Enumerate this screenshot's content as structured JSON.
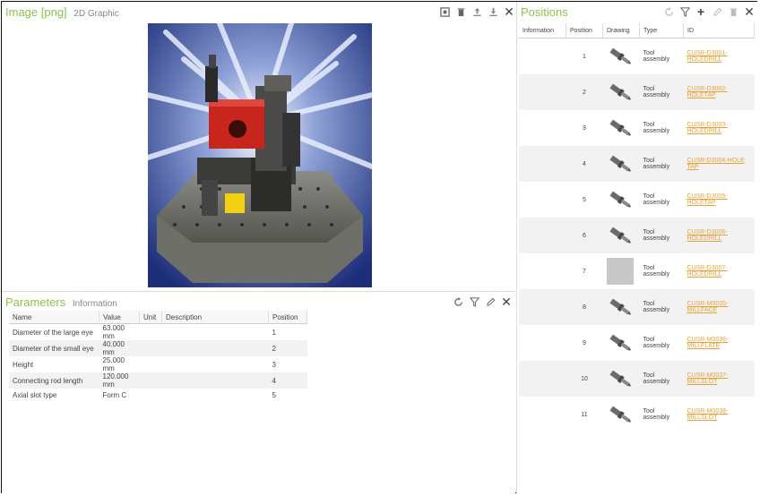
{
  "image_pane": {
    "tab_active": "Image [png]",
    "tab_inactive": "2D Graphic"
  },
  "parameters_pane": {
    "tab_active": "Parameters",
    "tab_inactive": "Information",
    "columns": [
      "Name",
      "Value",
      "Unit",
      "Description",
      "Position"
    ],
    "rows": [
      {
        "name": "Diameter of the large eye",
        "value": "63.000 mm",
        "unit": "",
        "description": "",
        "position": "1"
      },
      {
        "name": "Diameter of the small eye",
        "value": "40.000 mm",
        "unit": "",
        "description": "",
        "position": "2"
      },
      {
        "name": "Height",
        "value": "25.000 mm",
        "unit": "",
        "description": "",
        "position": "3"
      },
      {
        "name": "Connecting rod length",
        "value": "120.000 mm",
        "unit": "",
        "description": "",
        "position": "4"
      },
      {
        "name": "Axial slot type",
        "value": "Form C",
        "unit": "",
        "description": "",
        "position": "5"
      }
    ]
  },
  "positions_pane": {
    "title": "Positions",
    "columns": [
      "Information",
      "Position",
      "Drawing",
      "Type",
      "ID"
    ],
    "rows": [
      {
        "position": "1",
        "type": "Tool assembly",
        "id": "CUSR-D3001-HOLEDRILL"
      },
      {
        "position": "2",
        "type": "Tool assembly",
        "id": "CUSR-D3002-HOLETAP"
      },
      {
        "position": "3",
        "type": "Tool assembly",
        "id": "CUSR-D3003-HOLEDRILL"
      },
      {
        "position": "4",
        "type": "Tool assembly",
        "id": "CUSR-D3004-HOLE TAP"
      },
      {
        "position": "5",
        "type": "Tool assembly",
        "id": "CUSR-D3005-HOLETAP"
      },
      {
        "position": "6",
        "type": "Tool assembly",
        "id": "CUSR-D3006-HOLEDRILL"
      },
      {
        "position": "7",
        "type": "Tool assembly",
        "id": "CUSR-D3007-HOLEDRILL"
      },
      {
        "position": "8",
        "type": "Tool assembly",
        "id": "CUSR-M0035-MILLFACE"
      },
      {
        "position": "9",
        "type": "Tool assembly",
        "id": "CUSR-M0036-MILLFLATE"
      },
      {
        "position": "10",
        "type": "Tool assembly",
        "id": "CUSR-M0037-MILLSLOT"
      },
      {
        "position": "11",
        "type": "Tool assembly",
        "id": "CUSR-M0038-MILLSLOT"
      }
    ]
  }
}
